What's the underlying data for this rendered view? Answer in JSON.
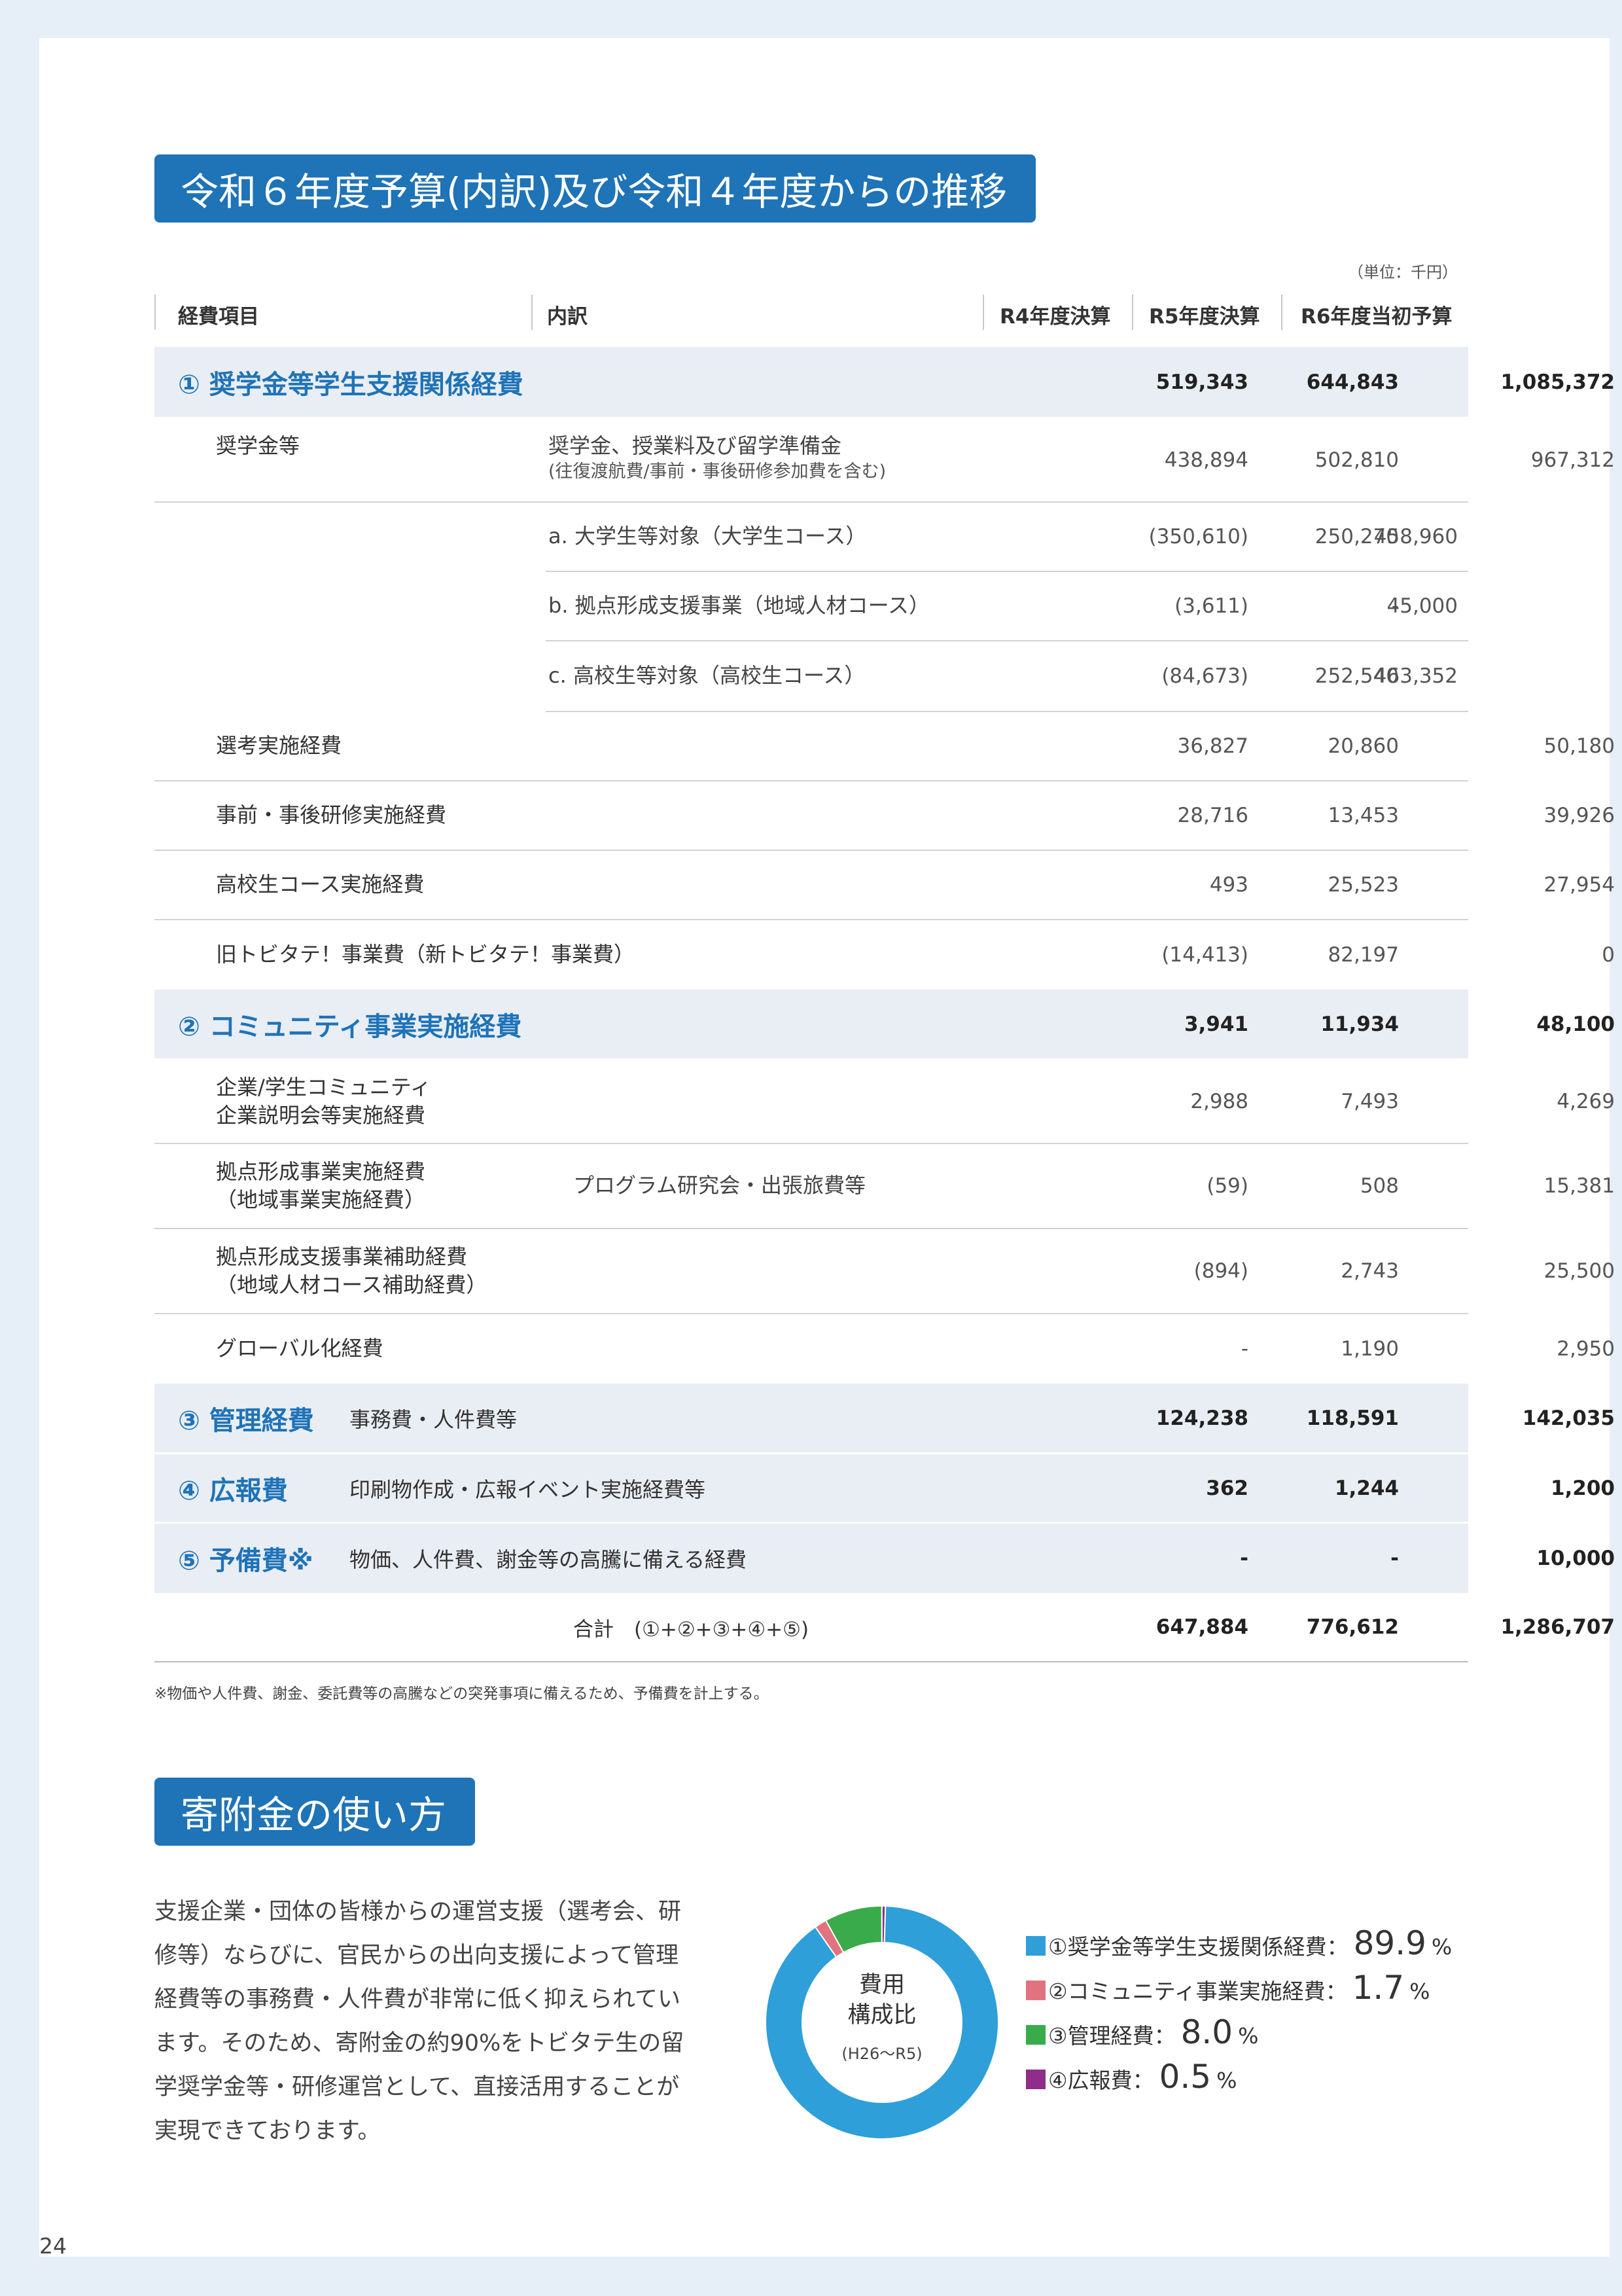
{
  "page_title": "令和６年度予算(内訳)及び令和４年度からの推移",
  "unit_note": "（単位：千円）",
  "columns": {
    "item": "経費項目",
    "breakdown": "内訳",
    "r4": "R4年度決算",
    "r5": "R5年度決算",
    "r6": "R6年度当初予算"
  },
  "rows": {
    "cat1": {
      "label": "① 奨学金等学生支援関係経費",
      "r4": "519,343",
      "r5": "644,843",
      "r6": "1,085,372"
    },
    "scholarship": {
      "label": "奨学金等",
      "sub_line1": "奨学金、授業料及び留学準備金",
      "sub_line2": "(往復渡航費/事前・事後研修参加費を含む)",
      "r4": "438,894",
      "r5": "502,810",
      "r6": "967,312"
    },
    "sch_a": {
      "sub": "a. 大学生等対象（大学生コース）",
      "r4": "(350,610)",
      "r5": "250,270",
      "r6": "458,960"
    },
    "sch_b": {
      "sub": "b. 拠点形成支援事業（地域人材コース）",
      "r4": "(3,611)",
      "r5": "-",
      "r6": "45,000"
    },
    "sch_c": {
      "sub": "c. 高校生等対象（高校生コース）",
      "r4": "(84,673)",
      "r5": "252,540",
      "r6": "463,352"
    },
    "selection": {
      "label": "選考実施経費",
      "r4": "36,827",
      "r5": "20,860",
      "r6": "50,180"
    },
    "training": {
      "label": "事前・事後研修実施経費",
      "r4": "28,716",
      "r5": "13,453",
      "r6": "39,926"
    },
    "highschool": {
      "label": "高校生コース実施経費",
      "r4": "493",
      "r5": "25,523",
      "r6": "27,954"
    },
    "tobitate": {
      "label": "旧トビタテ！事業費（新トビタテ！事業費）",
      "r4": "(14,413)",
      "r5": "82,197",
      "r6": "0"
    },
    "cat2": {
      "label": "② コミュニティ事業実施経費",
      "r4": "3,941",
      "r5": "11,934",
      "r6": "48,100"
    },
    "community": {
      "label_line1": "企業/学生コミュニティ",
      "label_line2": "企業説明会等実施経費",
      "r4": "2,988",
      "r5": "7,493",
      "r6": "4,269"
    },
    "base": {
      "label_line1": "拠点形成事業実施経費",
      "label_line2": "（地域事業実施経費）",
      "sub": "プログラム研究会・出張旅費等",
      "r4": "(59)",
      "r5": "508",
      "r6": "15,381"
    },
    "base_support": {
      "label_line1": "拠点形成支援事業補助経費",
      "label_line2": "（地域人材コース補助経費）",
      "r4": "(894)",
      "r5": "2,743",
      "r6": "25,500"
    },
    "global": {
      "label": "グローバル化経費",
      "r4": "-",
      "r5": "1,190",
      "r6": "2,950"
    },
    "cat3": {
      "label": "③ 管理経費",
      "note": "事務費・人件費等",
      "r4": "124,238",
      "r5": "118,591",
      "r6": "142,035"
    },
    "cat4": {
      "label": "④ 広報費",
      "note": "印刷物作成・広報イベント実施経費等",
      "r4": "362",
      "r5": "1,244",
      "r6": "1,200"
    },
    "cat5": {
      "label": "⑤ 予備費※",
      "note": "物価、人件費、謝金等の高騰に備える経費",
      "r4": "-",
      "r5": "-",
      "r6": "10,000"
    },
    "total": {
      "label": "合計　(①+②+③+④+⑤)",
      "r4": "647,884",
      "r5": "776,612",
      "r6": "1,286,707"
    }
  },
  "footnote": "※物価や人件費、謝金、委託費等の高騰などの突発事項に備えるため、予備費を計上する。",
  "donation_title": "寄附金の使い方",
  "donation_text": [
    "支援企業・団体の皆様からの運営支援（選考会、研",
    "修等）ならびに、官民からの出向支援によって管理",
    "経費等の事務費・人件費が非常に低く抑えられてい",
    "ます。そのため、寄附金の約90%をトビタテ生の留",
    "学奨学金等・研修運営として、直接活用することが",
    "実現できております。"
  ],
  "donut": {
    "center_line1": "費用",
    "center_line2": "構成比",
    "center_period": "(H26〜R5)"
  },
  "chart_data": {
    "type": "pie",
    "categories": [
      "①奨学金等学生支援関係経費",
      "②コミュニティ事業実施経費",
      "③管理経費",
      "④広報費"
    ],
    "values": [
      89.9,
      1.7,
      8.0,
      0.5
    ],
    "colors": [
      "#2e9fd8",
      "#e0737f",
      "#3aab4a",
      "#8e2d8a"
    ]
  },
  "legend": [
    {
      "label": "①奨学金等学生支援関係経費：",
      "value": "89.9",
      "unit": "%"
    },
    {
      "label": "②コミュニティ事業実施経費：",
      "value": "1.7",
      "unit": "%"
    },
    {
      "label": "③管理経費：",
      "value": "8.0",
      "unit": "%"
    },
    {
      "label": "④広報費：",
      "value": "0.5",
      "unit": "%"
    }
  ],
  "page_number": "24"
}
